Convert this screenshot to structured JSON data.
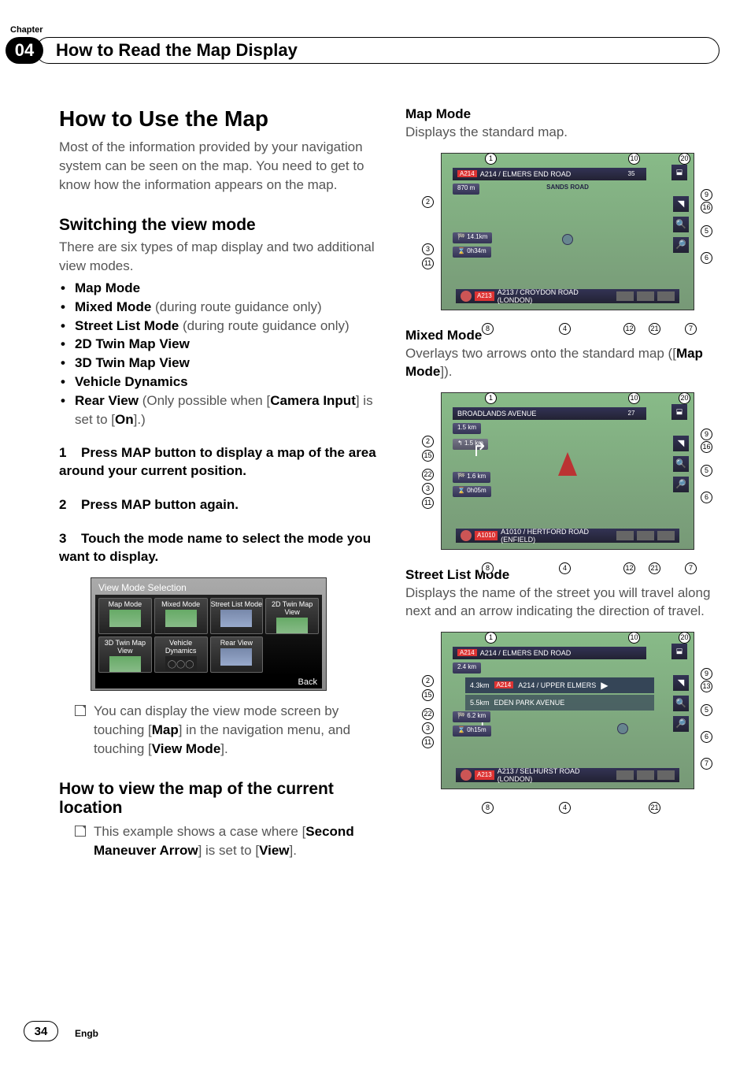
{
  "header": {
    "chapter_label": "Chapter",
    "chapter_number": "04",
    "title": "How to Read the Map Display"
  },
  "left": {
    "h1": "How to Use the Map",
    "intro": "Most of the information provided by your navigation system can be seen on the map. You need to get to know how the information appears on the map.",
    "h2_switch": "Switching the view mode",
    "switch_intro": "There are six types of map display and two additional view modes.",
    "bullets": {
      "b1": "Map Mode",
      "b2_bold": "Mixed Mode",
      "b2_rest": " (during route guidance only)",
      "b3_bold": "Street List Mode",
      "b3_rest": " (during route guidance only)",
      "b4": "2D Twin Map View",
      "b5": "3D Twin Map View",
      "b6": "Vehicle Dynamics",
      "b7_bold": "Rear View",
      "b7_rest1": " (Only possible when [",
      "b7_camera": "Camera Input",
      "b7_rest2": "] is set to [",
      "b7_on": "On",
      "b7_rest3": "].)"
    },
    "steps": {
      "s1_num": "1",
      "s1_text": "Press MAP button to display a map of the area around your current position.",
      "s2_num": "2",
      "s2_text": "Press MAP button again.",
      "s3_num": "3",
      "s3_text": "Touch the mode name to select the mode you want to display."
    },
    "vms": {
      "title": "View Mode Selection",
      "c1": "Map Mode",
      "c2": "Mixed Mode",
      "c3": "Street List Mode",
      "c4": "2D Twin Map View",
      "c5": "3D Twin Map View",
      "c6": "Vehicle Dynamics",
      "c7": "Rear View",
      "back": "Back"
    },
    "note1_pre": "You can display the view mode screen by touching [",
    "note1_map": "Map",
    "note1_mid": "] in the navigation menu, and touching [",
    "note1_view": "View Mode",
    "note1_post": "].",
    "h2_current": "How to view the map of the current location",
    "note2_pre": "This example shows a case where [",
    "note2_second": "Second Maneuver Arrow",
    "note2_mid": "] is set to [",
    "note2_view": "View",
    "note2_post": "]."
  },
  "right": {
    "map_mode_h": "Map Mode",
    "map_mode_d": "Displays the standard map.",
    "mixed_mode_h": "Mixed Mode",
    "mixed_mode_d_pre": "Overlays two arrows onto the standard map ([",
    "mixed_mode_d_bold": "Map Mode",
    "mixed_mode_d_post": "]).",
    "street_h": "Street List Mode",
    "street_d": "Displays the name of the street you will travel along next and an arrow indicating the direction of travel.",
    "fig1": {
      "top_road": "A214 / ELMERS END ROAD",
      "mid": "SANDS ROAD",
      "dist1": "870 m",
      "dist2": "14.1km",
      "time": "0h34m",
      "bottom": "A213 / CROYDON ROAD (LONDON)",
      "mini": "35"
    },
    "fig2": {
      "top_road": "BROADLANDS AVENUE",
      "dist1": "1.5 km",
      "dist1b": "1.5 km",
      "dist2": "1.6 km",
      "time": "0h05m",
      "bottom": "A1010 / HERTFORD ROAD (ENFIELD)",
      "mini": "27"
    },
    "fig3": {
      "top_road": "A214 / ELMERS END ROAD",
      "dist1": "2.4 km",
      "row1": "A214 / UPPER ELMERS",
      "row1_dist": "4.3km",
      "row2": "EDEN PARK AVENUE",
      "row2_dist": "5.5km",
      "dist2": "6.2 km",
      "time": "0h15m",
      "bottom": "A213 / SELHURST ROAD (LONDON)"
    }
  },
  "footer": {
    "page": "34",
    "lang": "Engb"
  }
}
